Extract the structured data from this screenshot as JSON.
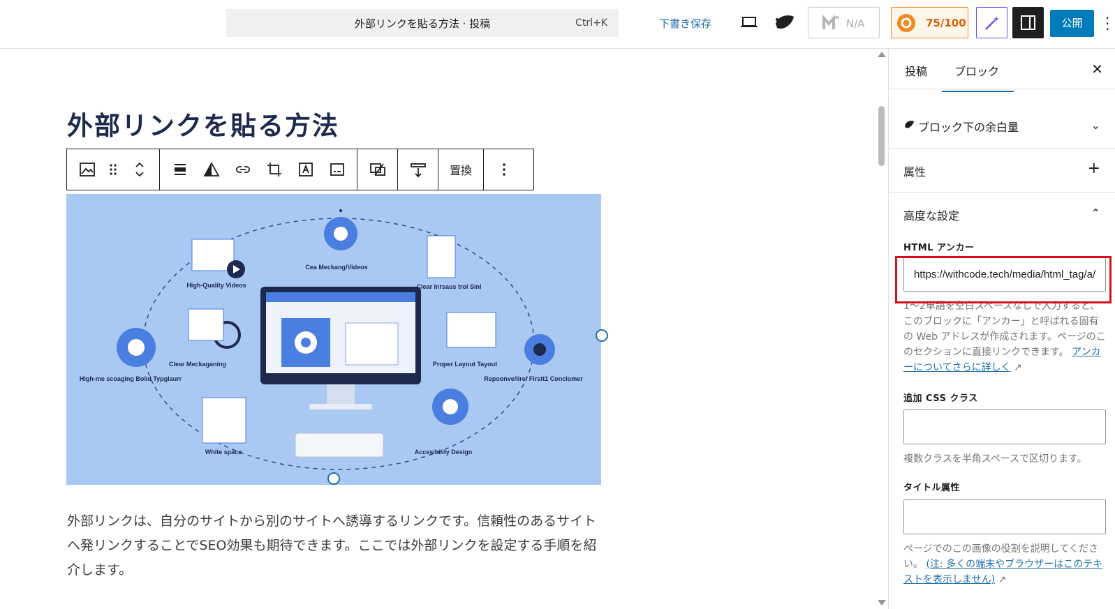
{
  "header": {
    "command_title": "外部リンクを貼る方法 · 投稿",
    "command_shortcut": "Ctrl+K",
    "save_draft": "下書き保存",
    "na_label": "N/A",
    "score": "75/100",
    "publish": "公開"
  },
  "post": {
    "title": "外部リンクを貼る方法",
    "paragraph": "外部リンクは、自分のサイトから別のサイトへ誘導するリンクです。信頼性のあるサイトへ発リンクすることでSEO効果も期待できます。ここでは外部リンクを設定する手順を紹介します。"
  },
  "toolbar": {
    "replace": "置換"
  },
  "image": {
    "labels": [
      "High-Quality Videos",
      "Cea Meckang/Videos",
      "Clear Inrsaus trol Sinl",
      "Clear Meckaganing",
      "Proper Layout Tayout",
      "High-me scoaging Bolid Typglaurr",
      "Repoonve/Iire/ Flrstt1 Conclomer",
      "White space",
      "Accesibility Design"
    ]
  },
  "panel": {
    "tab_post": "投稿",
    "tab_block": "ブロック",
    "section_spacing": "ブロック下の余白量",
    "section_attributes": "属性",
    "section_advanced": "高度な設定",
    "html_anchor_label": "HTML アンカー",
    "html_anchor_value": "https://withcode.tech/media/html_tag/a/",
    "anchor_help": "1〜2単語を空白スペースなしで入力すると、このブロックに「アンカー」と呼ばれる固有の Web アドレスが作成されます。ページのこのセクションに直接リンクできます。",
    "anchor_link": "アンカーについてさらに詳しく",
    "css_label": "追加 CSS クラス",
    "css_value": "",
    "css_help": "複数クラスを半角スペースで区切ります。",
    "title_label": "タイトル属性",
    "title_value": "",
    "title_help": "ページでのこの画像の役割を説明してください。",
    "title_link": "(注: 多くの端末やブラウザーはこのテキストを表示しません)"
  },
  "colors": {
    "accent": "#1e6fa8",
    "publish": "#007cba",
    "highlight": "#d6111d",
    "score": "#f08a1e"
  }
}
